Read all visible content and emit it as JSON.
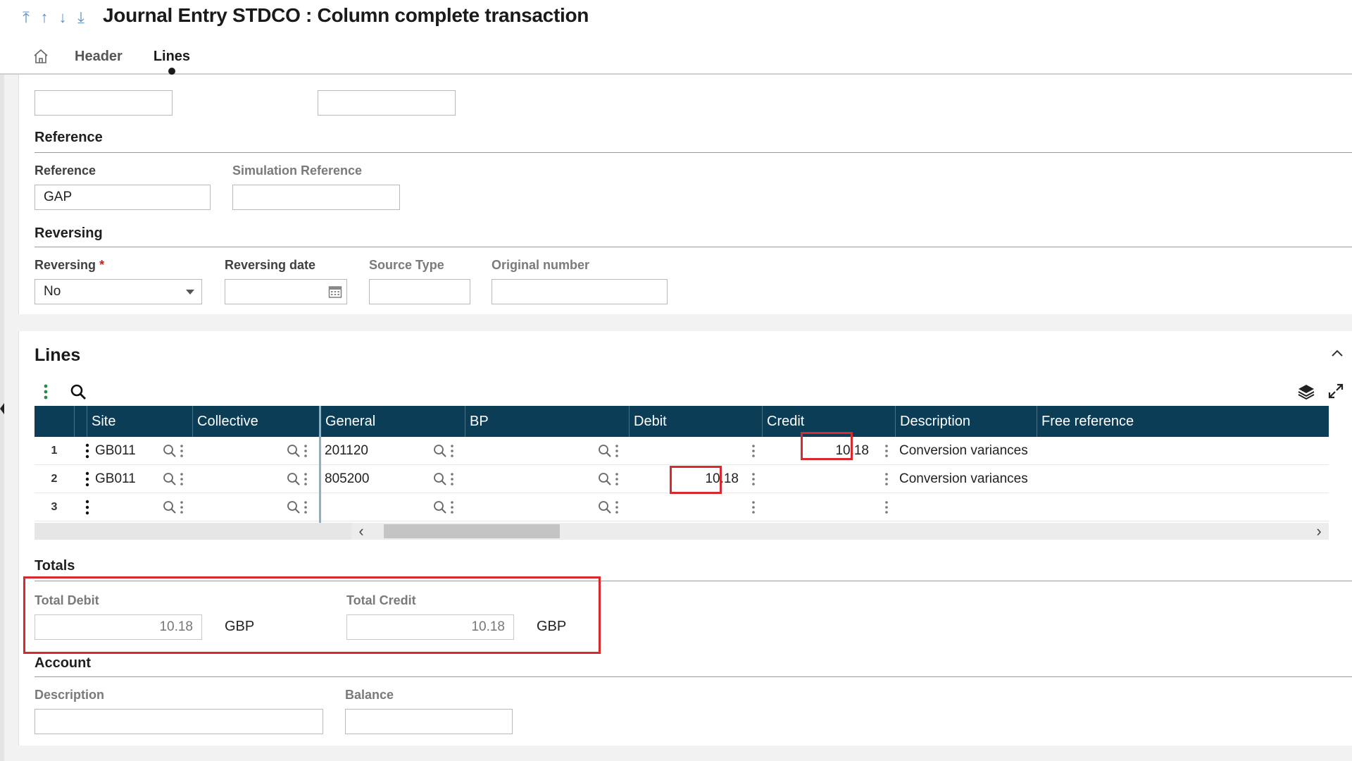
{
  "title": "Journal Entry STDCO : Column complete transaction",
  "nav": [
    "⤒",
    "↑",
    "↓",
    "⤓"
  ],
  "tabs": {
    "header": "Header",
    "lines": "Lines"
  },
  "reference_section": {
    "title": "Reference",
    "reference_label": "Reference",
    "reference_value": "GAP",
    "simulation_label": "Simulation Reference",
    "simulation_value": ""
  },
  "reversing_section": {
    "title": "Reversing",
    "reversing_label": "Reversing",
    "required_mark": "*",
    "reversing_value": "No",
    "reversing_date_label": "Reversing date",
    "reversing_date_value": "",
    "source_type_label": "Source Type",
    "source_type_value": "",
    "original_number_label": "Original number",
    "original_number_value": ""
  },
  "lines": {
    "title": "Lines",
    "columns": [
      "Site",
      "Collective",
      "General",
      "BP",
      "Debit",
      "Credit",
      "Description",
      "Free reference"
    ],
    "rows": [
      {
        "num": "1",
        "site": "GB011",
        "collective": "",
        "general": "201120",
        "bp": "",
        "debit": "",
        "credit": "10.18",
        "description": "Conversion variances"
      },
      {
        "num": "2",
        "site": "GB011",
        "collective": "",
        "general": "805200",
        "bp": "",
        "debit": "10.18",
        "credit": "",
        "description": "Conversion variances"
      },
      {
        "num": "3",
        "site": "",
        "collective": "",
        "general": "",
        "bp": "",
        "debit": "",
        "credit": "",
        "description": ""
      }
    ]
  },
  "totals": {
    "title": "Totals",
    "total_debit_label": "Total Debit",
    "total_debit_value": "10.18",
    "total_debit_currency": "GBP",
    "total_credit_label": "Total Credit",
    "total_credit_value": "10.18",
    "total_credit_currency": "GBP"
  },
  "account": {
    "title": "Account",
    "description_label": "Description",
    "description_value": "",
    "balance_label": "Balance",
    "balance_value": ""
  },
  "colors": {
    "grid_header": "#0c3d57",
    "highlight": "#d72a2f",
    "accent": "#5a8fc4"
  },
  "icons": {
    "nav": [
      "arrow-first-icon",
      "arrow-up-icon",
      "arrow-down-icon",
      "arrow-last-icon"
    ],
    "tab_home": "home-icon",
    "field": [
      "magnifier-icon",
      "vertical-dots-icon",
      "calendar-icon",
      "chevron-down-icon"
    ],
    "toolbar": [
      "vertical-dots-icon",
      "search-icon",
      "layers-icon",
      "expand-icon",
      "chevron-up-icon"
    ]
  }
}
